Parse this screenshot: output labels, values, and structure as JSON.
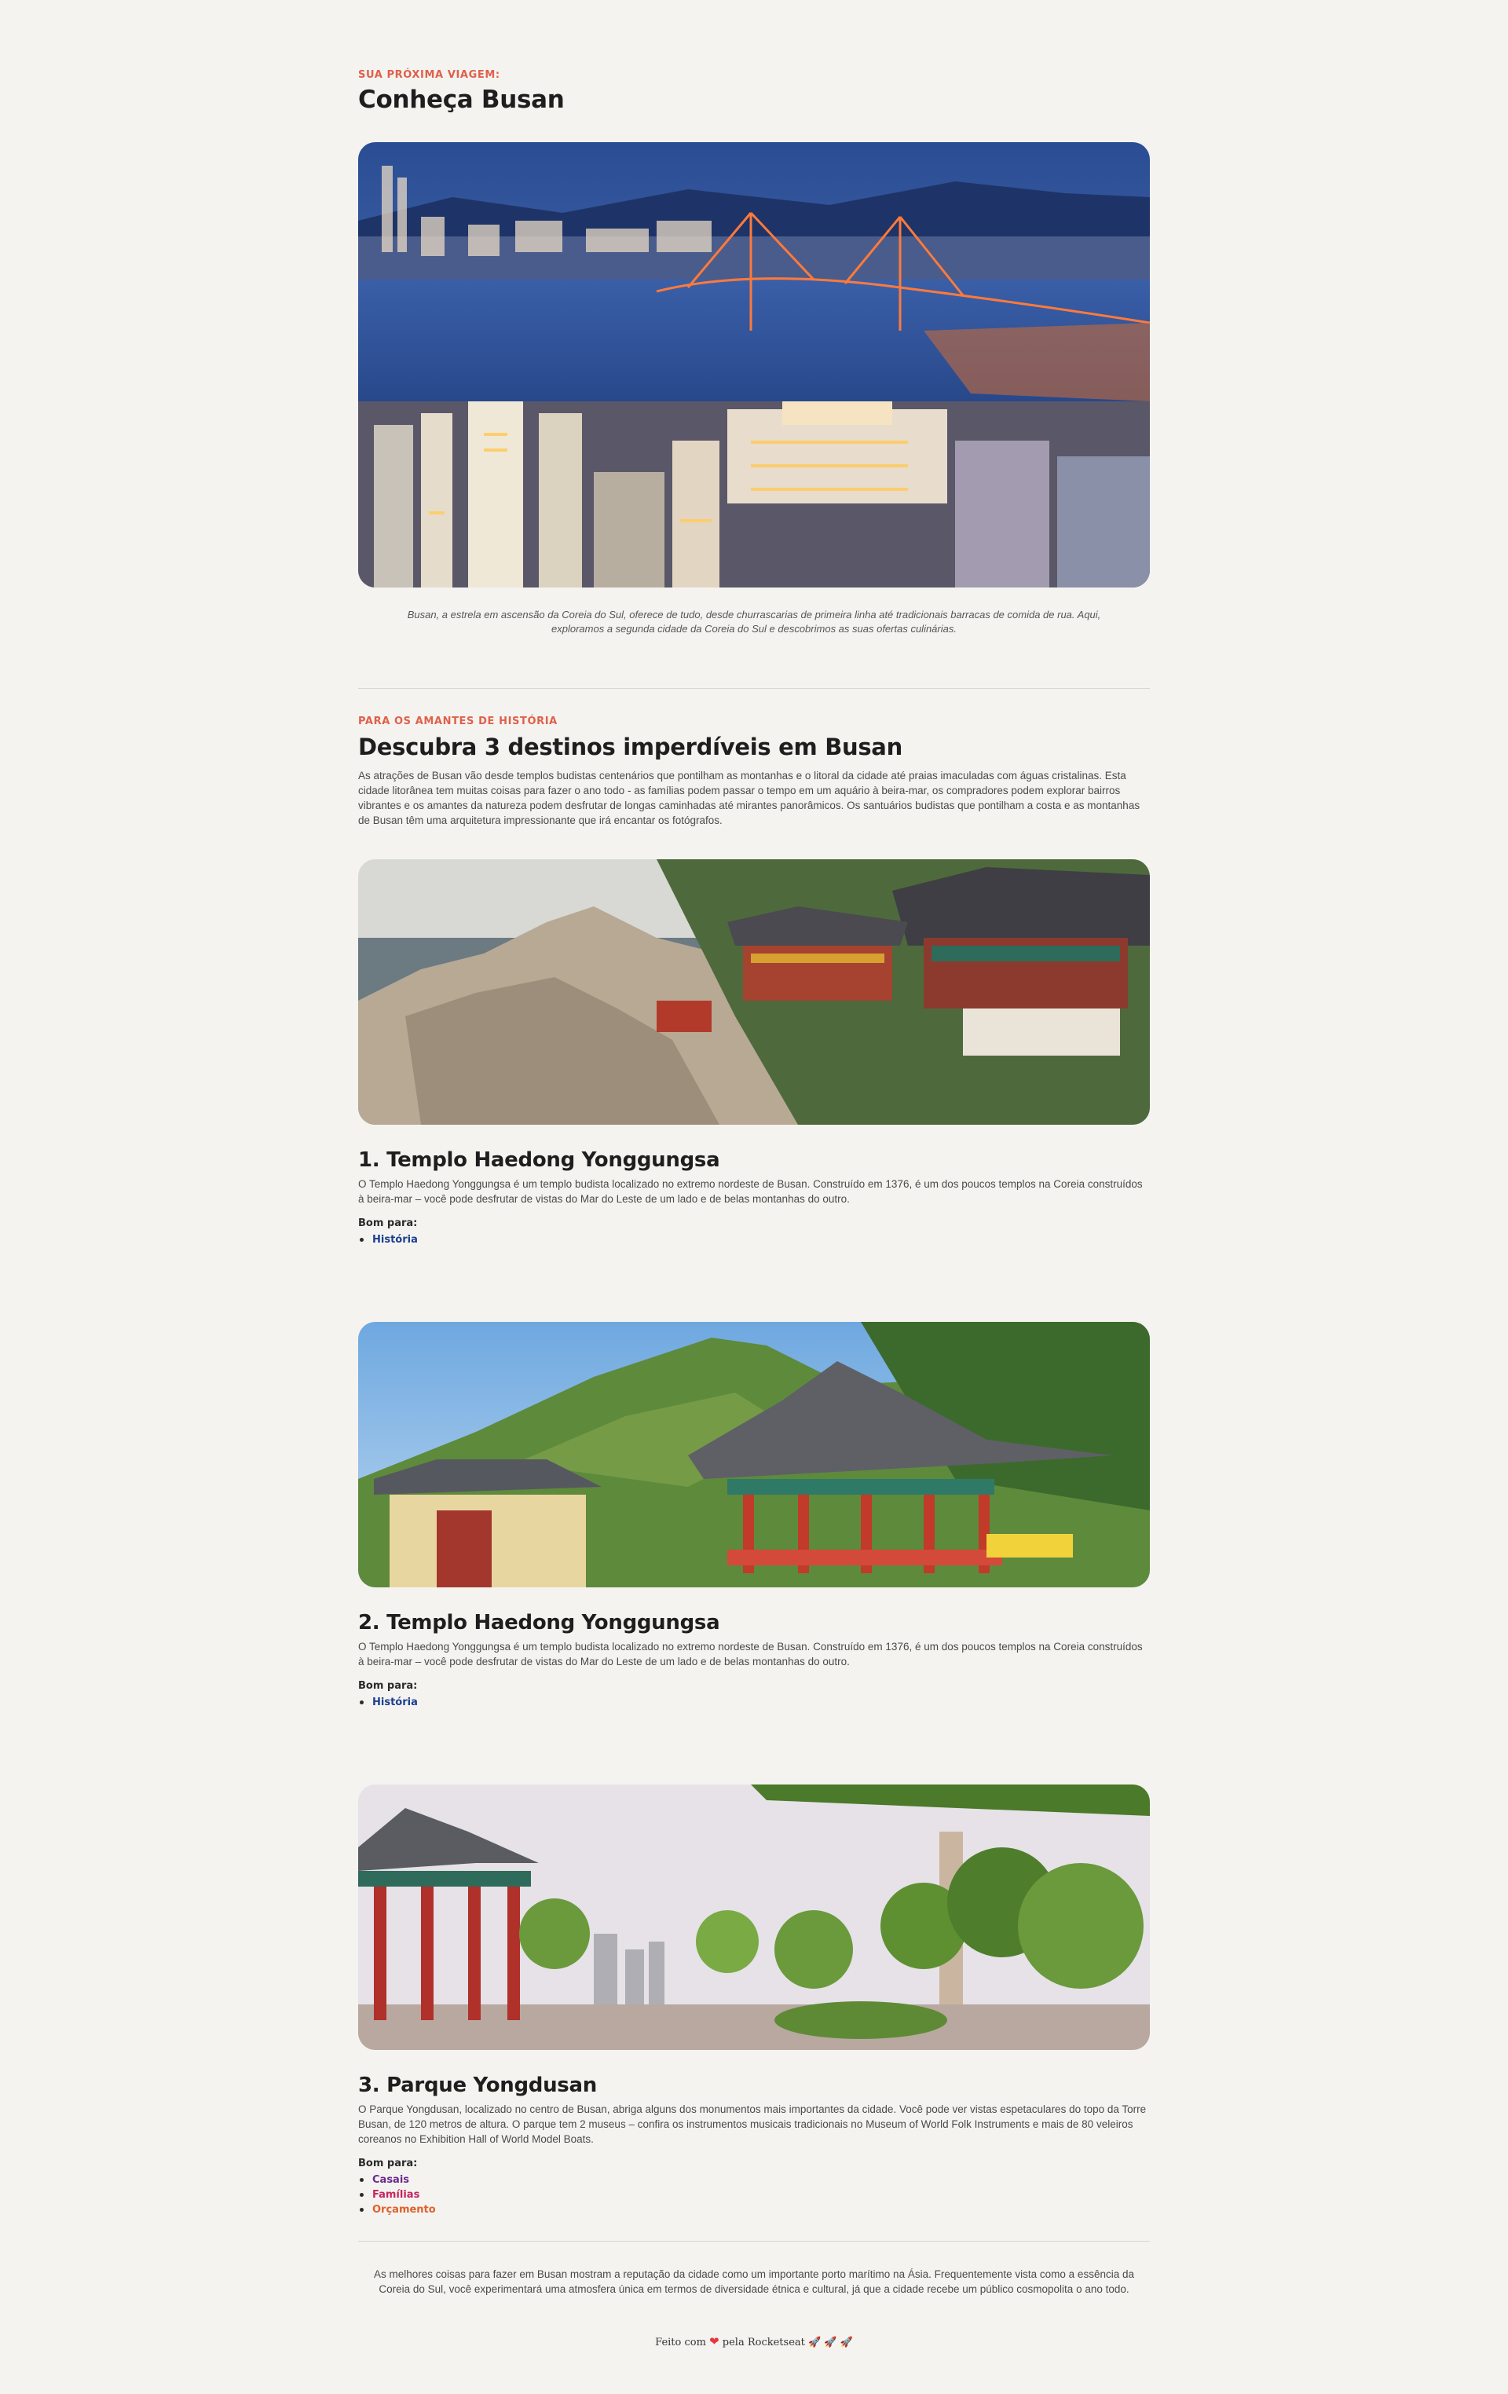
{
  "hero": {
    "eyebrow": "SUA PRÓXIMA VIAGEM:",
    "title": "Conheça Busan",
    "caption": "Busan, a estrela em ascensão da Coreia do Sul, oferece de tudo, desde churrascarias de primeira linha até tradicionais barracas de comida de rua. Aqui, exploramos a segunda cidade da Coreia do Sul e descobrimos as suas ofertas culinárias."
  },
  "section": {
    "eyebrow": "PARA OS AMANTES DE HISTÓRIA",
    "title": "Descubra 3 destinos imperdíveis em Busan",
    "description": "As atrações de Busan vão desde templos budistas centenários que pontilham as montanhas e o litoral da cidade até praias imaculadas com águas cristalinas. Esta cidade litorânea tem muitas coisas para fazer o ano todo - as famílias podem passar o tempo em um aquário à beira-mar, os compradores podem explorar bairros vibrantes e os amantes da natureza podem desfrutar de longas caminhadas até mirantes panorâmicos. Os santuários budistas que pontilham a costa e as montanhas de Busan têm uma arquitetura impressionante que irá encantar os fotógrafos."
  },
  "destinations": [
    {
      "title": "1. Templo Haedong Yonggungsa",
      "description": "O Templo Haedong Yonggungsa é um templo budista localizado no extremo nordeste de Busan. Construído em 1376, é um dos poucos templos na Coreia construídos à beira-mar – você pode desfrutar de vistas do Mar do Leste de um lado e de belas montanhas do outro.",
      "good_for_label": "Bom para:",
      "tags": [
        {
          "label": "História",
          "color": "#1d3d8f"
        }
      ]
    },
    {
      "title": "2. Templo Haedong Yonggungsa",
      "description": "O Templo Haedong Yonggungsa é um templo budista localizado no extremo nordeste de Busan. Construído em 1376, é um dos poucos templos na Coreia construídos à beira-mar – você pode desfrutar de vistas do Mar do Leste de um lado e de belas montanhas do outro.",
      "good_for_label": "Bom para:",
      "tags": [
        {
          "label": "História",
          "color": "#1d3d8f"
        }
      ]
    },
    {
      "title": "3. Parque Yongdusan",
      "description": "O Parque Yongdusan, localizado no centro de Busan, abriga alguns dos monumentos mais importantes da cidade. Você pode ver vistas espetaculares do topo da Torre Busan, de 120 metros de altura. O parque tem 2 museus – confira os instrumentos musicais tradicionais no Museum of World Folk Instruments e mais de 80 veleiros coreanos no Exhibition Hall of World Model Boats.",
      "good_for_label": "Bom para:",
      "tags": [
        {
          "label": "Casais",
          "color": "#6b2a8c"
        },
        {
          "label": "Famílias",
          "color": "#c8245e"
        },
        {
          "label": "Orçamento",
          "color": "#e0602a"
        }
      ]
    }
  ],
  "closing": "As melhores coisas para fazer em Busan mostram a reputação da cidade como um importante porto marítimo na Ásia. Frequentemente vista como a essência da Coreia do Sul, você experimentará uma atmosfera única em termos de diversidade étnica e cultural, já que a cidade recebe um público cosmopolita o ano todo.",
  "footer": {
    "prefix": "Feito com",
    "heart": "❤",
    "suffix": "pela Rocketseat",
    "rockets": "🚀 🚀 🚀"
  },
  "icons": {
    "heart": "heart-icon",
    "rocket": "rocket-icon"
  }
}
